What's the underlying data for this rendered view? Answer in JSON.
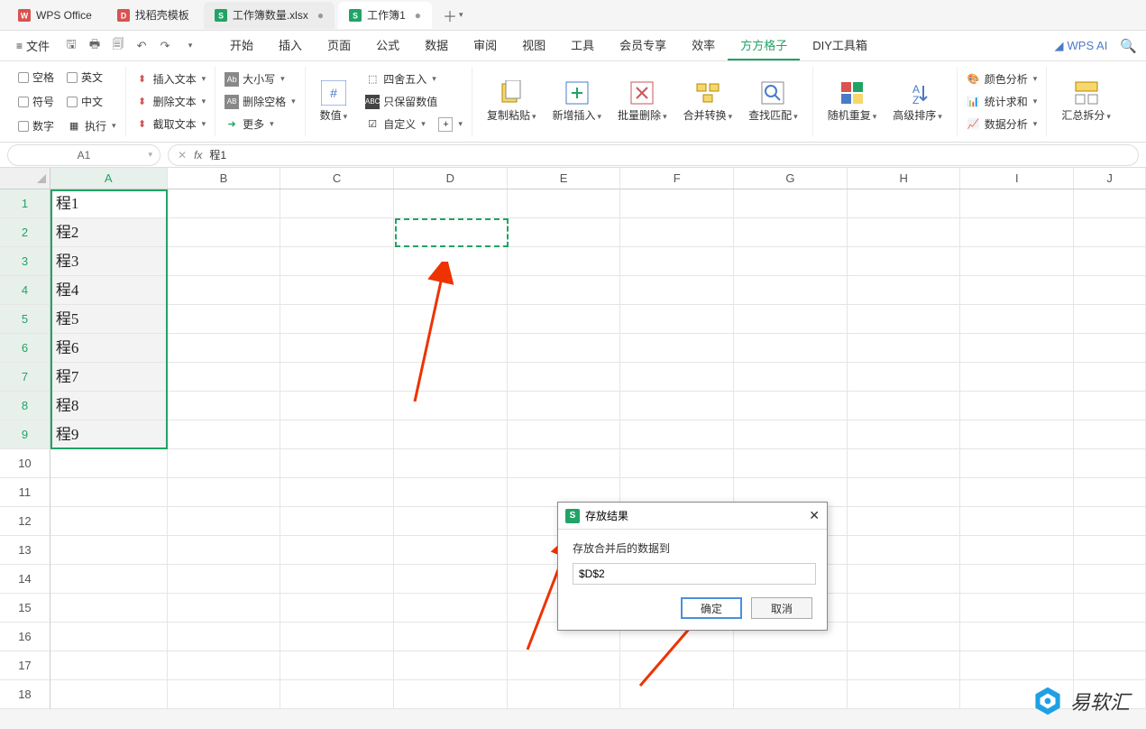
{
  "app": {
    "name": "WPS Office"
  },
  "tabs": [
    {
      "label": "找稻壳模板",
      "icon": "D",
      "color": "#d9534f"
    },
    {
      "label": "工作簿数量.xlsx",
      "icon": "S",
      "color": "#21a366",
      "dot": "●"
    },
    {
      "label": "工作簿1",
      "icon": "S",
      "color": "#21a366",
      "dot": "●"
    }
  ],
  "file_menu": "文件",
  "menu": {
    "items": [
      "开始",
      "插入",
      "页面",
      "公式",
      "数据",
      "审阅",
      "视图",
      "工具",
      "会员专享",
      "效率",
      "方方格子",
      "DIY工具箱"
    ],
    "active": "方方格子",
    "wps_ai": "WPS AI"
  },
  "ribbon": {
    "g1": {
      "space": "空格",
      "sym": "符号",
      "num": "数字",
      "en": "英文",
      "cn": "中文",
      "exec": "执行"
    },
    "g2": {
      "ins": "插入文本",
      "del": "删除文本",
      "cut": "截取文本"
    },
    "g3": {
      "case": "大小写",
      "delsp": "删除空格",
      "more": "更多"
    },
    "g4": {
      "numval": "数值",
      "round": "四舍五入",
      "keepnum": "只保留数值",
      "custom": "自定义"
    },
    "g5": {
      "copy": "复制粘贴",
      "addins": "新增插入",
      "batchdel": "批量删除",
      "merge": "合并转换",
      "find": "查找匹配"
    },
    "g6": {
      "rand": "随机重复",
      "sort": "高级排序"
    },
    "g7": {
      "color": "颜色分析",
      "stat": "统计求和",
      "data": "数据分析"
    },
    "g8": {
      "split": "汇总拆分"
    }
  },
  "formula_bar": {
    "name": "A1",
    "fx": "fx",
    "value": "程1"
  },
  "columns": [
    "A",
    "B",
    "C",
    "D",
    "E",
    "F",
    "G",
    "H",
    "I",
    "J"
  ],
  "cells": {
    "A1": "程1",
    "A2": "程2",
    "A3": "程3",
    "A4": "程4",
    "A5": "程5",
    "A6": "程6",
    "A7": "程7",
    "A8": "程8",
    "A9": "程9"
  },
  "dialog": {
    "title": "存放结果",
    "label": "存放合并后的数据到",
    "value": "$D$2",
    "ok": "确定",
    "cancel": "取消"
  },
  "watermark": "易软汇"
}
